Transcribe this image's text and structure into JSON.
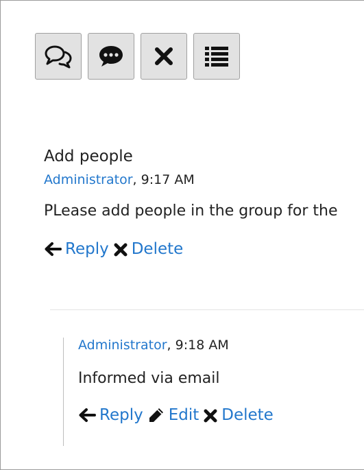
{
  "toolbar": {
    "buttons": [
      {
        "icon": "comments-icon"
      },
      {
        "icon": "comment-icon"
      },
      {
        "icon": "close-icon"
      },
      {
        "icon": "list-icon"
      }
    ]
  },
  "post": {
    "title": "Add people",
    "author": "Administrator",
    "time": ", 9:17 AM",
    "body": "PLease add people in the group for the",
    "actions": {
      "reply_label": "Reply",
      "delete_label": "Delete"
    }
  },
  "reply": {
    "author": "Administrator",
    "time": ", 9:18 AM",
    "body": "Informed via email",
    "actions": {
      "reply_label": "Reply",
      "edit_label": "Edit",
      "delete_label": "Delete"
    }
  },
  "colors": {
    "link": "#2277cc",
    "text": "#222222",
    "button_bg": "#e2e2e2"
  }
}
